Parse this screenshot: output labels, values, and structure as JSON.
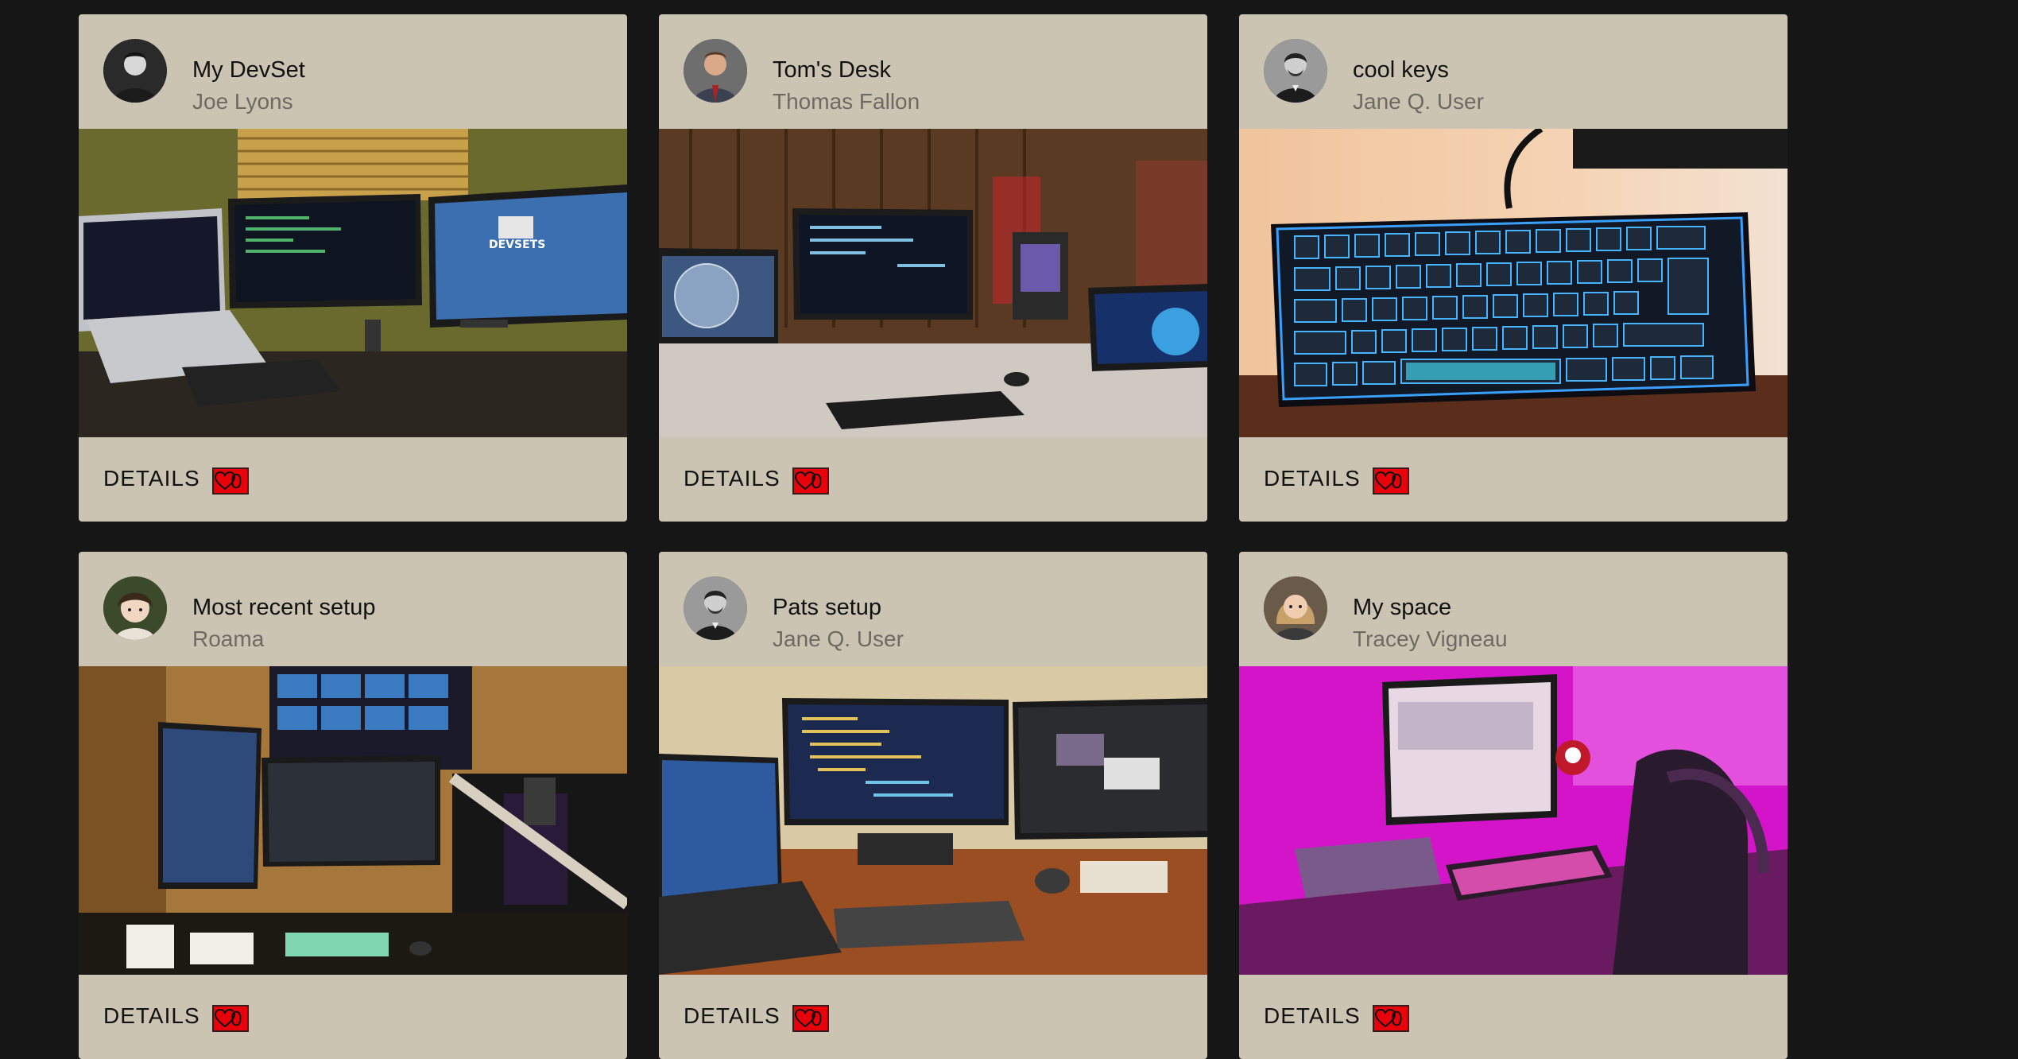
{
  "cards": [
    {
      "title": "My DevSet",
      "author": "Joe Lyons",
      "details_label": "DETAILS",
      "likes": "0",
      "image": "desk-setup-three-monitors-photo",
      "avatar": "user-avatar-photo"
    },
    {
      "title": "Tom's Desk",
      "author": "Thomas Fallon",
      "details_label": "DETAILS",
      "likes": "0",
      "image": "desk-setup-globe-laptop-photo",
      "avatar": "user-avatar-photo"
    },
    {
      "title": "cool keys",
      "author": "Jane Q. User",
      "details_label": "DETAILS",
      "likes": "0",
      "image": "rgb-keyboard-photo",
      "avatar": "lincoln-avatar-photo"
    },
    {
      "title": "Most recent setup",
      "author": "Roama",
      "details_label": "DETAILS",
      "likes": "0",
      "image": "streaming-setup-photo",
      "avatar": "anime-avatar"
    },
    {
      "title": "Pats setup",
      "author": "Jane Q. User",
      "details_label": "DETAILS",
      "likes": "0",
      "image": "dual-monitor-desk-photo",
      "avatar": "lincoln-avatar-photo"
    },
    {
      "title": "My space",
      "author": "Tracey Vigneau",
      "details_label": "DETAILS",
      "likes": "0",
      "image": "pink-lit-desk-photo",
      "avatar": "user-avatar-photo"
    }
  ],
  "colors": {
    "background": "#161616",
    "card": "#ccc4b2",
    "like_button": "#e8000b"
  }
}
